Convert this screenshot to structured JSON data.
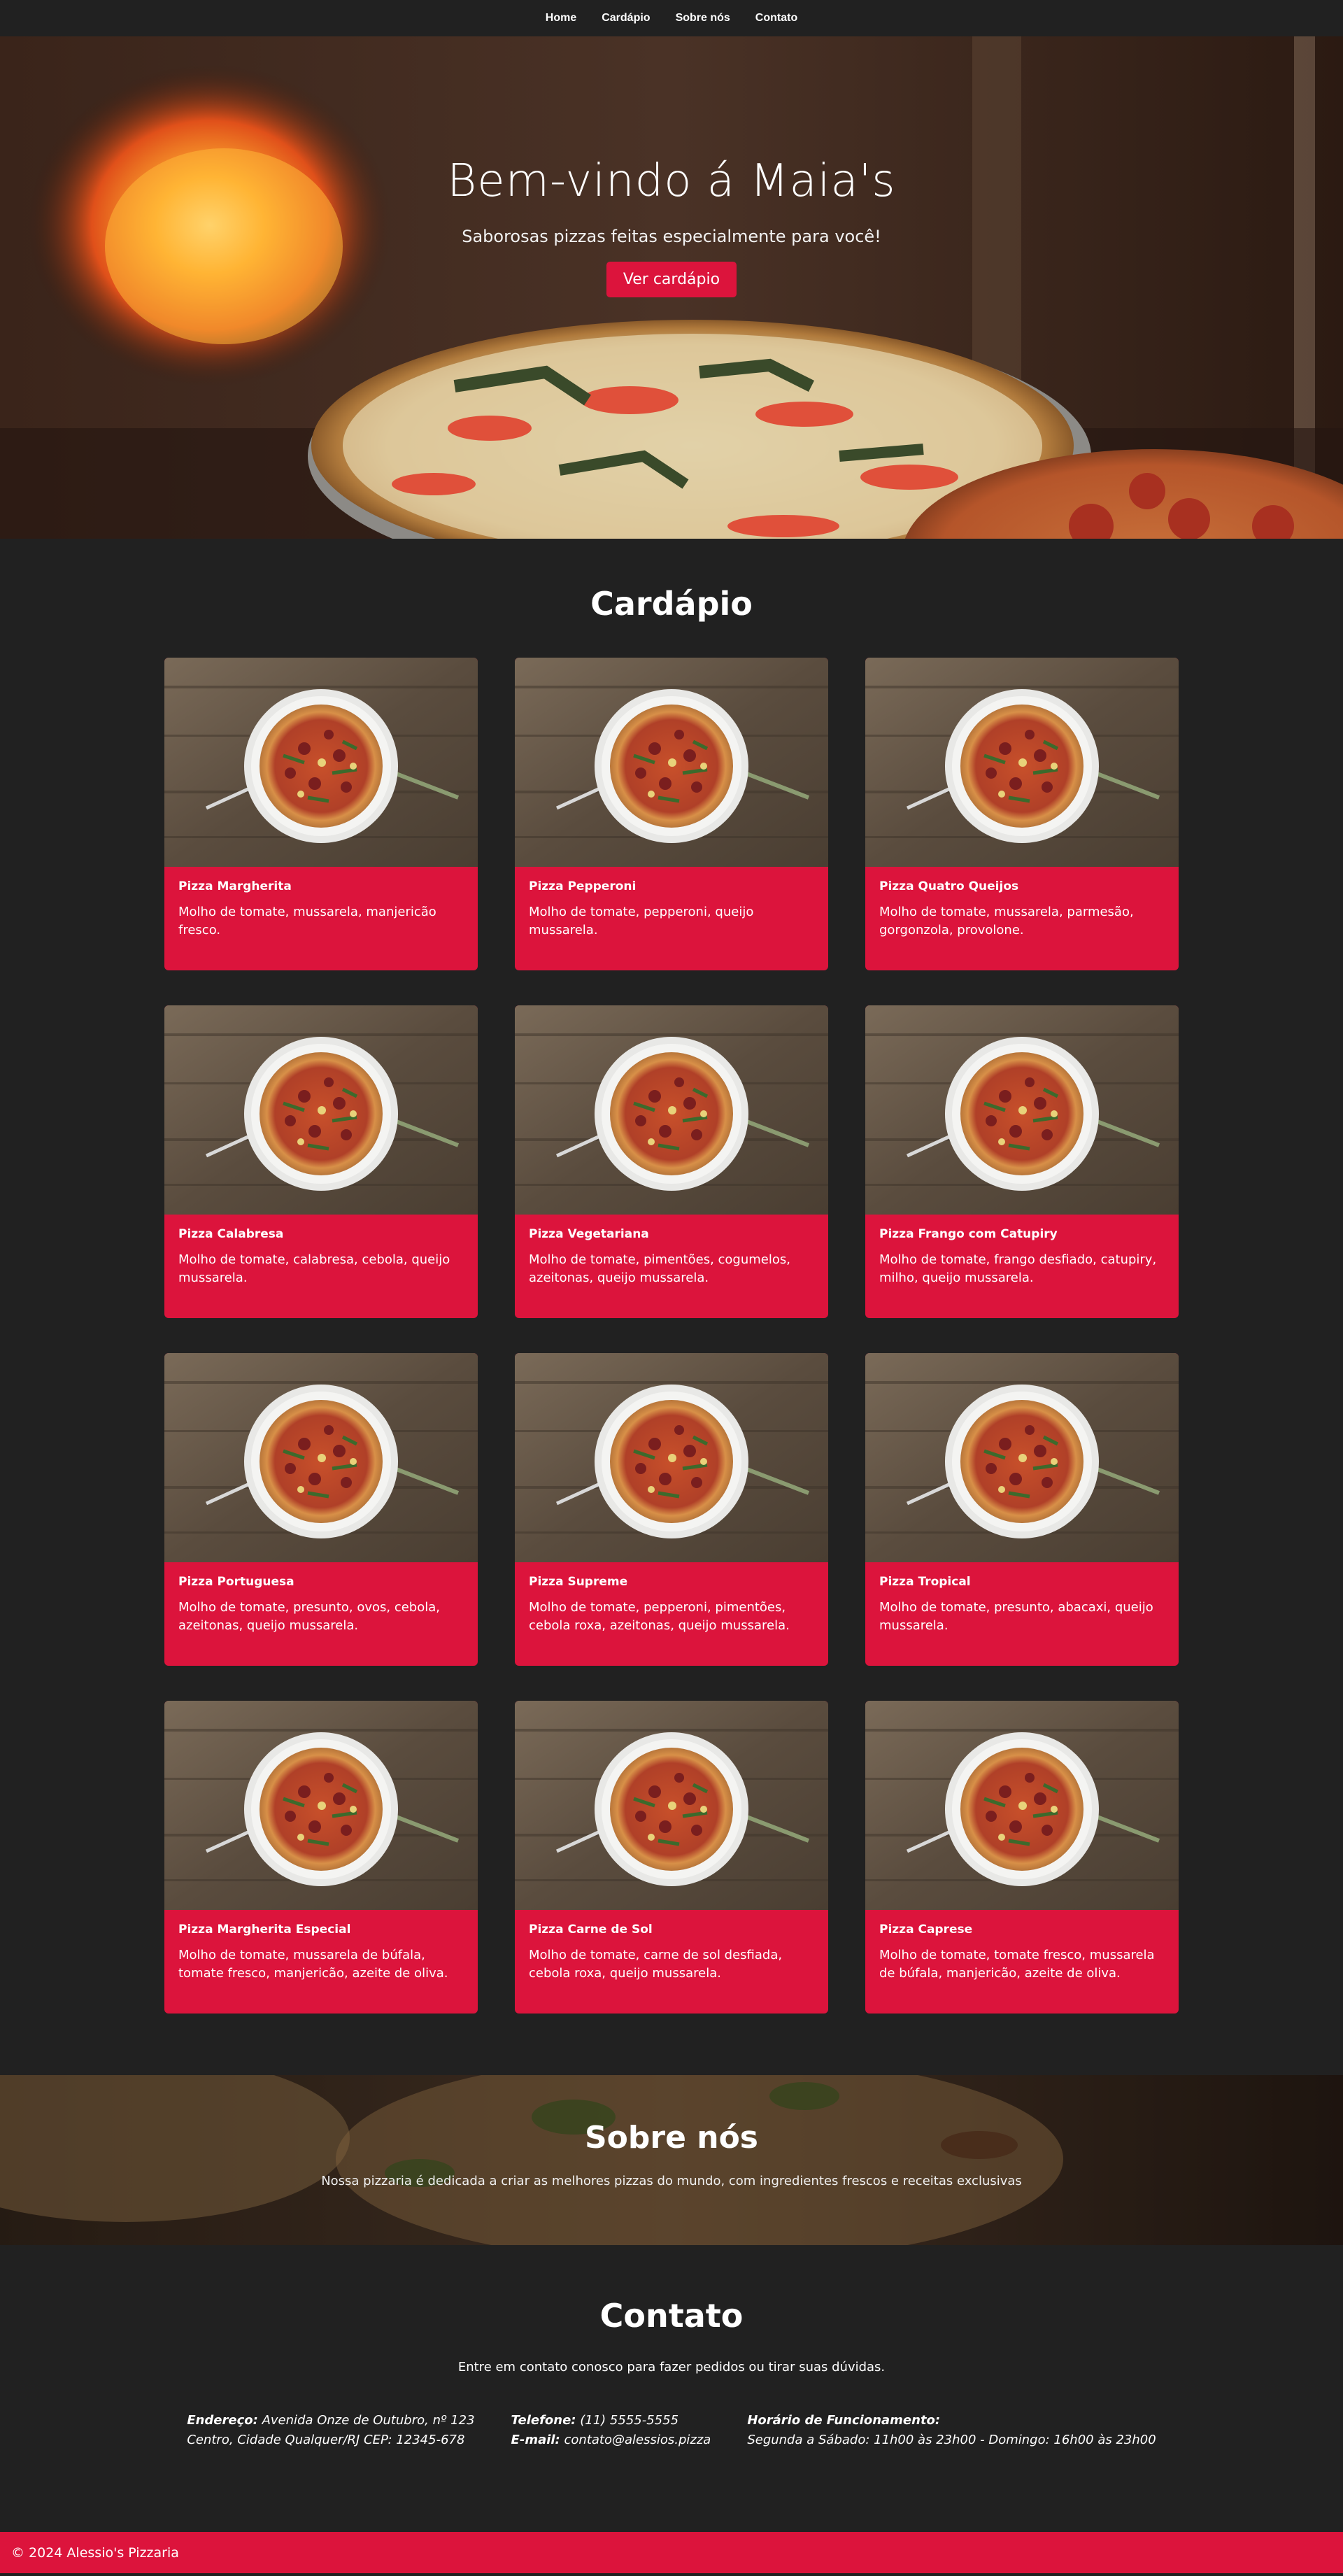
{
  "nav": {
    "items": [
      {
        "label": "Home"
      },
      {
        "label": "Cardápio"
      },
      {
        "label": "Sobre nós"
      },
      {
        "label": "Contato"
      }
    ]
  },
  "hero": {
    "title": "Bem-vindo á Maia's",
    "subtitle": "Saborosas pizzas feitas especialmente para você!",
    "button_label": "Ver cardápio"
  },
  "menu": {
    "title": "Cardápio",
    "items": [
      {
        "name": "Pizza Margherita",
        "description": "Molho de tomate, mussarela, manjericão fresco."
      },
      {
        "name": "Pizza Pepperoni",
        "description": "Molho de tomate, pepperoni, queijo mussarela."
      },
      {
        "name": "Pizza Quatro Queijos",
        "description": "Molho de tomate, mussarela, parmesão, gorgonzola, provolone."
      },
      {
        "name": "Pizza Calabresa",
        "description": "Molho de tomate, calabresa, cebola, queijo mussarela."
      },
      {
        "name": "Pizza Vegetariana",
        "description": "Molho de tomate, pimentões, cogumelos, azeitonas, queijo mussarela."
      },
      {
        "name": "Pizza Frango com Catupiry",
        "description": "Molho de tomate, frango desfiado, catupiry, milho, queijo mussarela."
      },
      {
        "name": "Pizza Portuguesa",
        "description": "Molho de tomate, presunto, ovos, cebola, azeitonas, queijo mussarela."
      },
      {
        "name": "Pizza Supreme",
        "description": "Molho de tomate, pepperoni, pimentões, cebola roxa, azeitonas, queijo mussarela."
      },
      {
        "name": "Pizza Tropical",
        "description": "Molho de tomate, presunto, abacaxi, queijo mussarela."
      },
      {
        "name": "Pizza Margherita Especial",
        "description": "Molho de tomate, mussarela de búfala, tomate fresco, manjericão, azeite de oliva."
      },
      {
        "name": "Pizza Carne de Sol",
        "description": "Molho de tomate, carne de sol desfiada, cebola roxa, queijo mussarela."
      },
      {
        "name": "Pizza Caprese",
        "description": "Molho de tomate, tomate fresco, mussarela de búfala, manjericão, azeite de oliva."
      }
    ]
  },
  "about": {
    "title": "Sobre nós",
    "text": "Nossa pizzaria é dedicada a criar as melhores pizzas do mundo, com ingredientes frescos e receitas exclusivas"
  },
  "contact": {
    "title": "Contato",
    "subtitle": "Entre em contato conosco para fazer pedidos ou tirar suas dúvidas.",
    "address_label": "Endereço:",
    "address_line1": "Avenida Onze de Outubro, nº 123",
    "address_line2": "Centro, Cidade Qualquer/RJ CEP: 12345-678",
    "phone_label": "Telefone:",
    "phone": "(11) 5555-5555",
    "email_label": "E-mail:",
    "email": "contato@alessios.pizza",
    "hours_label": "Horário de Funcionamento:",
    "hours": "Segunda a Sábado: 11h00 às 23h00 - Domingo: 16h00 às 23h00"
  },
  "footer": {
    "text": "© 2024 Alessio's Pizzaria"
  },
  "colors": {
    "accent": "#dc143c",
    "background": "#212121"
  }
}
